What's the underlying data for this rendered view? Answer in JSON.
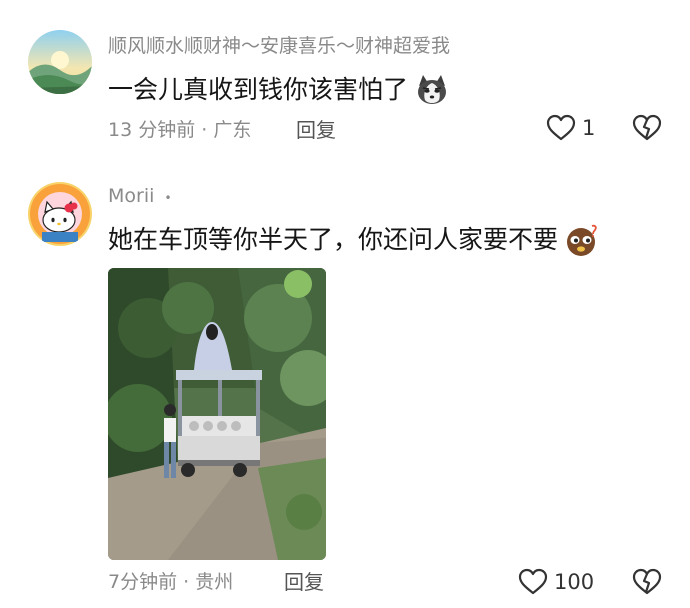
{
  "comments": [
    {
      "username": "顺风顺水顺财神～安康喜乐～财神超爱我",
      "text": "一会儿真收到钱你该害怕了",
      "emoji_icon": "husky-dog-emoji",
      "time": "13 分钟前 · 广东",
      "reply_label": "回复",
      "likes": "1"
    },
    {
      "username": "Morii",
      "username_suffix": "•",
      "text": "她在车顶等你半天了，你还问人家要不要",
      "emoji_icon": "shy-face-emoji",
      "image_description": "ghost-on-truck-photo",
      "time": "7分钟前 · 贵州",
      "reply_label": "回复",
      "likes": "100"
    }
  ],
  "colors": {
    "meta_text": "#8a8a8a",
    "body_text": "#161616",
    "icon_stroke": "#333333"
  }
}
